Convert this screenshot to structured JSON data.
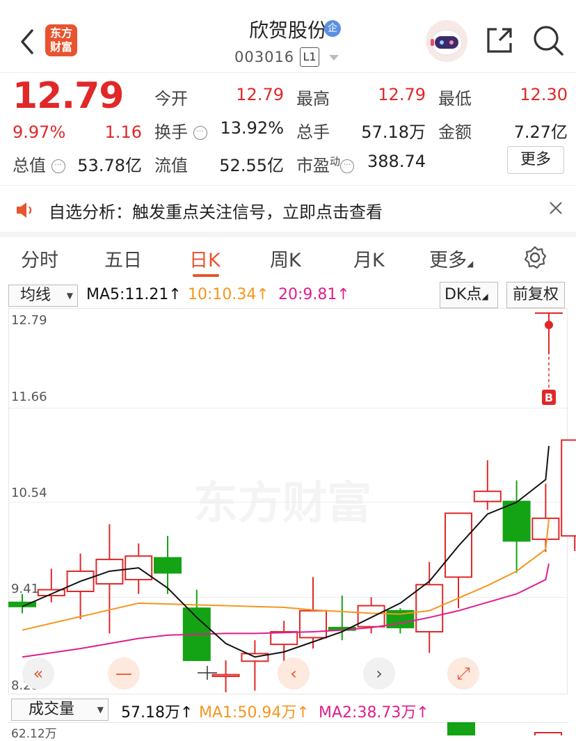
{
  "header": {
    "back_icon": "chevron-left-icon",
    "logo_text_line1": "东方",
    "logo_text_line2": "财富",
    "stock_name": "欣贺股份",
    "qi_badge": "企",
    "stock_code": "003016",
    "level_badge": "L1",
    "share_icon": "share-icon",
    "search_icon": "search-icon"
  },
  "quote": {
    "price": "12.79",
    "change_pct": "9.97%",
    "change_abs": "1.16",
    "fields": {
      "open_label": "今开",
      "open": "12.79",
      "high_label": "最高",
      "high": "12.79",
      "low_label": "最低",
      "low": "12.30",
      "turnover_label": "换手",
      "turnover": "13.92%",
      "volume_label": "总手",
      "volume": "57.18万",
      "amount_label": "金额",
      "amount": "7.27亿",
      "total_value_label": "总值",
      "total_value": "53.78亿",
      "float_value_label": "流值",
      "float_value": "52.55亿",
      "pe_label": "市盈",
      "pe_sup": "动",
      "pe": "388.74"
    },
    "more_label": "更多"
  },
  "notice": {
    "text": "自选分析：触发重点关注信号，立即点击查看",
    "speaker_icon": "speaker-icon",
    "close_icon": "close-icon"
  },
  "tabs": [
    {
      "label": "分时"
    },
    {
      "label": "五日"
    },
    {
      "label": "日K"
    },
    {
      "label": "周K"
    },
    {
      "label": "月K"
    },
    {
      "label": "更多"
    }
  ],
  "settings_icon": "gear-icon",
  "ma_bar": {
    "select_label": "均线",
    "ma5": "MA5:11.21↑",
    "ma10": "10:10.34↑",
    "ma20": "20:9.81↑",
    "dk_label": "DK点",
    "fq_label": "前复权"
  },
  "chart_data": {
    "type": "candlestick",
    "y_ticks": [
      "12.79",
      "11.66",
      "10.54",
      "9.41",
      "8.28"
    ],
    "ylim": [
      8.28,
      12.79
    ],
    "watermark": "东方财富",
    "marker": "B",
    "candles": [
      {
        "o": 9.35,
        "c": 9.3,
        "h": 9.45,
        "l": 9.22
      },
      {
        "o": 9.43,
        "c": 9.5,
        "h": 9.75,
        "l": 9.35
      },
      {
        "o": 9.48,
        "c": 9.72,
        "h": 9.93,
        "l": 9.15
      },
      {
        "o": 9.57,
        "c": 9.86,
        "h": 10.28,
        "l": 8.98
      },
      {
        "o": 9.62,
        "c": 9.9,
        "h": 10.05,
        "l": 9.45
      },
      {
        "o": 9.88,
        "c": 9.7,
        "h": 10.14,
        "l": 9.45
      },
      {
        "o": 9.28,
        "c": 8.66,
        "h": 9.5,
        "l": 8.66
      },
      {
        "o": 8.47,
        "c": 8.49,
        "h": 8.66,
        "l": 8.28
      },
      {
        "o": 8.65,
        "c": 8.74,
        "h": 8.9,
        "l": 8.3
      },
      {
        "o": 8.85,
        "c": 9.0,
        "h": 9.13,
        "l": 8.65
      },
      {
        "o": 8.93,
        "c": 9.25,
        "h": 9.65,
        "l": 8.8
      },
      {
        "o": 9.05,
        "c": 9.02,
        "h": 9.43,
        "l": 8.9
      },
      {
        "o": 9.06,
        "c": 9.31,
        "h": 9.41,
        "l": 8.98
      },
      {
        "o": 9.25,
        "c": 9.05,
        "h": 9.28,
        "l": 8.98
      },
      {
        "o": 9.0,
        "c": 9.56,
        "h": 9.83,
        "l": 8.75
      },
      {
        "o": 9.65,
        "c": 10.41,
        "h": 10.41,
        "l": 9.28
      },
      {
        "o": 10.55,
        "c": 10.67,
        "h": 11.04,
        "l": 10.45
      },
      {
        "o": 10.55,
        "c": 10.08,
        "h": 10.8,
        "l": 9.7
      },
      {
        "o": 10.1,
        "c": 10.35,
        "h": 10.76,
        "l": 9.95
      },
      {
        "o": 10.14,
        "c": 11.28,
        "h": 11.28,
        "l": 9.96
      },
      {
        "o": 12.3,
        "c": 12.79,
        "h": 12.79,
        "l": 12.3
      }
    ],
    "ma5": [
      9.3,
      9.45,
      9.6,
      9.72,
      9.76,
      9.52,
      9.17,
      8.86,
      8.7,
      8.76,
      8.88,
      9.0,
      9.17,
      9.34,
      9.6,
      10.02,
      10.4,
      10.54,
      10.81,
      11.21
    ],
    "ma10": [
      9.02,
      9.1,
      9.18,
      9.26,
      9.34,
      9.33,
      9.32,
      9.31,
      9.3,
      9.29,
      9.26,
      9.24,
      9.22,
      9.21,
      9.25,
      9.4,
      9.55,
      9.72,
      9.98,
      10.34
    ],
    "ma20": [
      8.7,
      8.75,
      8.8,
      8.86,
      8.92,
      8.96,
      8.97,
      8.98,
      8.98,
      8.99,
      9.0,
      9.02,
      9.05,
      9.1,
      9.17,
      9.25,
      9.35,
      9.45,
      9.62,
      9.81
    ]
  },
  "nav_icons": [
    "double-left-icon",
    "minus-icon",
    "chevron-left-icon",
    "chevron-right-icon",
    "expand-icon"
  ],
  "volume_bar": {
    "select_label": "成交量",
    "vol": "57.18万↑",
    "ma1": "MA1:50.94万↑",
    "ma2": "MA2:38.73万↑",
    "axis_top": "62.12万"
  },
  "colors": {
    "up": "#e02828",
    "down": "#14a314",
    "accent": "#e8542e",
    "ma5": "#111111",
    "ma10": "#f5961e",
    "ma20": "#e01e8c"
  }
}
